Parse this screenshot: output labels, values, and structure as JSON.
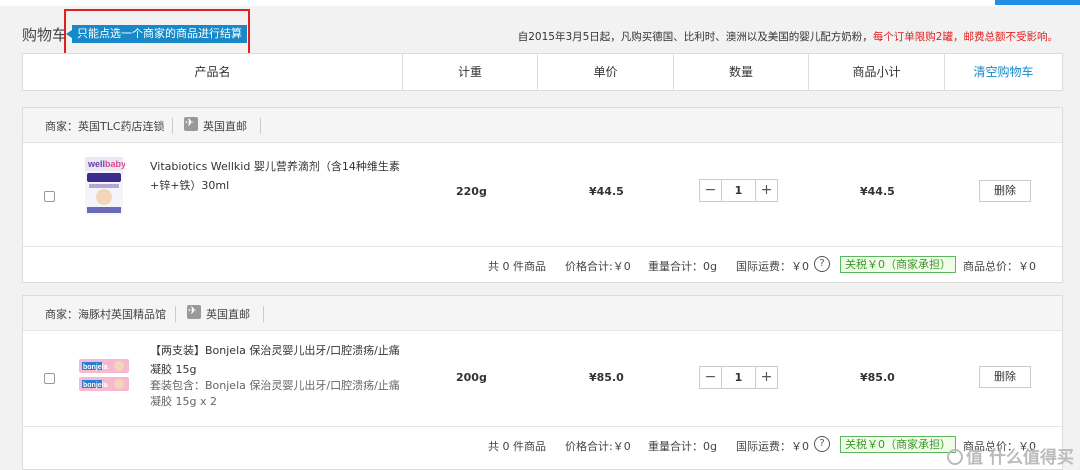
{
  "cart": {
    "title": "购物车",
    "hint": "只能点选一个商家的商品进行结算",
    "notice_main": "自2015年3月5日起，凡购买德国、比利时、澳洲以及美国的婴儿配方奶粉，",
    "notice_red": "每个订单限购2罐，邮费总额不受影响。"
  },
  "table_header": {
    "product": "产品名",
    "weight": "计重",
    "unit_price": "单价",
    "quantity": "数量",
    "subtotal": "商品小计",
    "clear_cart": "清空购物车"
  },
  "stores": [
    {
      "name": "商家：英国TLC药店连锁",
      "shipping": "英国直邮",
      "item": {
        "name": "Vitabiotics Wellkid 婴儿营养滴剂（含14种维生素+锌+铁）30ml",
        "sub": "",
        "weight": "220g",
        "price": "¥44.5",
        "qty": "1",
        "subtotal": "¥44.5",
        "delete": "删除"
      },
      "summary": {
        "count": "共 0 件商品",
        "price_total": "价格合计:￥0",
        "weight_total": "重量合计：0g",
        "shipping_fee": "国际运费：￥0",
        "tax": "关税￥0（商家承担）",
        "total": "商品总价：￥0"
      }
    },
    {
      "name": "商家：海豚村英国精品馆",
      "shipping": "英国直邮",
      "item": {
        "name": "【两支装】Bonjela 保治灵婴儿出牙/口腔溃疡/止痛凝胶 15g",
        "sub": "套装包含：Bonjela 保治灵婴儿出牙/口腔溃疡/止痛凝胶 15g x 2",
        "weight": "200g",
        "price": "¥85.0",
        "qty": "1",
        "subtotal": "¥85.0",
        "delete": "删除"
      },
      "summary": {
        "count": "共 0 件商品",
        "price_total": "价格合计:￥0",
        "weight_total": "重量合计：0g",
        "shipping_fee": "国际运费：￥0",
        "tax": "关税￥0（商家承担）",
        "total": "商品总价：￥0"
      }
    }
  ],
  "icons": {
    "minus": "−",
    "plus": "+",
    "help": "?",
    "plane": "plane-icon"
  },
  "colors": {
    "accent_blue": "#1789c8",
    "alert_red": "#e02020",
    "tax_green": "#3a9a2a"
  },
  "watermark": "值 什么值得买"
}
